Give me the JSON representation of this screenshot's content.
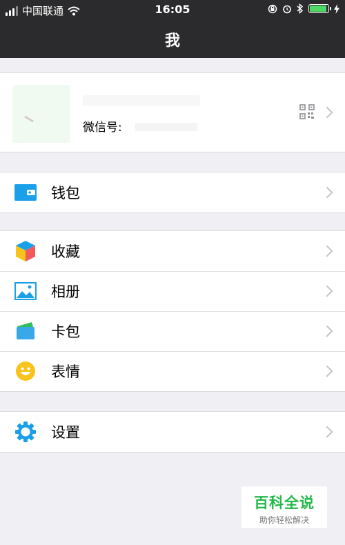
{
  "status_bar": {
    "carrier": "中国联通",
    "time": "16:05",
    "icons": [
      "signal-icon",
      "wifi-icon",
      "rotation-lock-icon",
      "alarm-icon",
      "bluetooth-icon",
      "battery-icon",
      "charging-icon"
    ],
    "battery_color": "#4cd964"
  },
  "nav": {
    "title": "我"
  },
  "profile": {
    "wechat_id_label": "微信号:",
    "icons": [
      "avatar",
      "qr-code-icon",
      "chevron-right-icon"
    ]
  },
  "menu": {
    "wallet": {
      "label": "钱包",
      "icon": "wallet-icon",
      "color": "#1aa0e8"
    },
    "favorites": {
      "label": "收藏",
      "icon": "favorites-cube-icon"
    },
    "album": {
      "label": "相册",
      "icon": "album-icon",
      "color": "#1aa0e8"
    },
    "cards": {
      "label": "卡包",
      "icon": "card-wallet-icon"
    },
    "stickers": {
      "label": "表情",
      "icon": "smiley-icon",
      "color": "#f7c31c"
    },
    "settings": {
      "label": "设置",
      "icon": "gear-icon",
      "color": "#1aa0e8"
    }
  },
  "watermark": {
    "main": "百科全说",
    "sub": "助你轻松解决",
    "color": "#23b84a"
  }
}
